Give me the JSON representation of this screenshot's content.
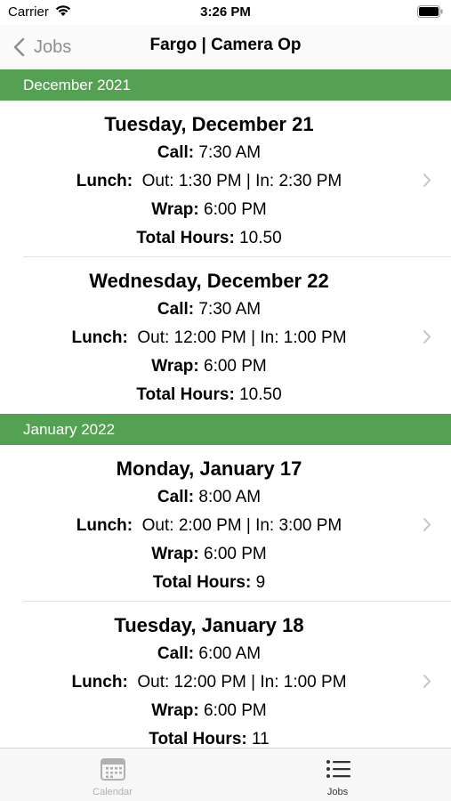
{
  "status_bar": {
    "carrier": "Carrier",
    "time": "3:26 PM"
  },
  "nav": {
    "back_label": "Jobs",
    "title": "Fargo | Camera Op"
  },
  "sections": [
    {
      "header": "December 2021",
      "rows": [
        {
          "date": "Tuesday, December 21",
          "call_label": "Call:",
          "call": "7:30 AM",
          "lunch_label": "Lunch:",
          "lunch": "Out: 1:30 PM | In: 2:30 PM",
          "wrap_label": "Wrap:",
          "wrap": "6:00 PM",
          "total_label": "Total Hours:",
          "total": "10.50"
        },
        {
          "date": "Wednesday, December 22",
          "call_label": "Call:",
          "call": "7:30 AM",
          "lunch_label": "Lunch:",
          "lunch": "Out: 12:00 PM | In: 1:00 PM",
          "wrap_label": "Wrap:",
          "wrap": "6:00 PM",
          "total_label": "Total Hours:",
          "total": "10.50"
        }
      ]
    },
    {
      "header": "January 2022",
      "rows": [
        {
          "date": "Monday, January 17",
          "call_label": "Call:",
          "call": "8:00 AM",
          "lunch_label": "Lunch:",
          "lunch": "Out: 2:00 PM | In: 3:00 PM",
          "wrap_label": "Wrap:",
          "wrap": "6:00 PM",
          "total_label": "Total Hours:",
          "total": "9"
        },
        {
          "date": "Tuesday, January 18",
          "call_label": "Call:",
          "call": "6:00 AM",
          "lunch_label": "Lunch:",
          "lunch": "Out: 12:00 PM | In: 1:00 PM",
          "wrap_label": "Wrap:",
          "wrap": "6:00 PM",
          "total_label": "Total Hours:",
          "total": "11"
        }
      ]
    }
  ],
  "tabs": [
    {
      "label": "Calendar",
      "icon": "calendar-icon"
    },
    {
      "label": "Jobs",
      "icon": "list-icon"
    }
  ],
  "colors": {
    "section_header": "#55a153",
    "back_gray": "#8e8e93"
  }
}
